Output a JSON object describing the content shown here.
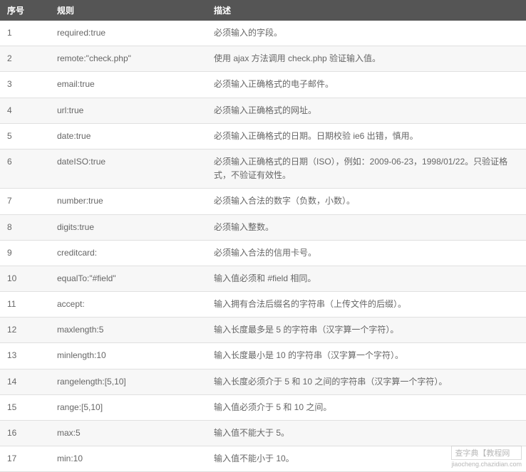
{
  "table": {
    "headers": {
      "seq": "序号",
      "rule": "规则",
      "desc": "描述"
    },
    "rows": [
      {
        "seq": "1",
        "rule": "required:true",
        "desc": "必须输入的字段。"
      },
      {
        "seq": "2",
        "rule": "remote:\"check.php\"",
        "desc": "使用 ajax 方法调用 check.php 验证输入值。"
      },
      {
        "seq": "3",
        "rule": "email:true",
        "desc": "必须输入正确格式的电子邮件。"
      },
      {
        "seq": "4",
        "rule": "url:true",
        "desc": "必须输入正确格式的网址。"
      },
      {
        "seq": "5",
        "rule": "date:true",
        "desc": "必须输入正确格式的日期。日期校验 ie6 出错，慎用。"
      },
      {
        "seq": "6",
        "rule": "dateISO:true",
        "desc": "必须输入正确格式的日期（ISO），例如：2009-06-23，1998/01/22。只验证格式，不验证有效性。"
      },
      {
        "seq": "7",
        "rule": "number:true",
        "desc": "必须输入合法的数字（负数，小数）。"
      },
      {
        "seq": "8",
        "rule": "digits:true",
        "desc": "必须输入整数。"
      },
      {
        "seq": "9",
        "rule": "creditcard:",
        "desc": "必须输入合法的信用卡号。"
      },
      {
        "seq": "10",
        "rule": "equalTo:\"#field\"",
        "desc": "输入值必须和 #field 相同。"
      },
      {
        "seq": "11",
        "rule": "accept:",
        "desc": "输入拥有合法后缀名的字符串（上传文件的后缀）。"
      },
      {
        "seq": "12",
        "rule": "maxlength:5",
        "desc": "输入长度最多是 5 的字符串（汉字算一个字符）。"
      },
      {
        "seq": "13",
        "rule": "minlength:10",
        "desc": "输入长度最小是 10 的字符串（汉字算一个字符）。"
      },
      {
        "seq": "14",
        "rule": "rangelength:[5,10]",
        "desc": "输入长度必须介于 5 和 10 之间的字符串（汉字算一个字符）。"
      },
      {
        "seq": "15",
        "rule": "range:[5,10]",
        "desc": "输入值必须介于 5 和 10 之间。"
      },
      {
        "seq": "16",
        "rule": "max:5",
        "desc": "输入值不能大于 5。"
      },
      {
        "seq": "17",
        "rule": "min:10",
        "desc": "输入值不能小于 10。"
      }
    ]
  },
  "watermark": {
    "top": "查字典【教程网",
    "bottom": "jiaocheng.chazidian.com"
  }
}
